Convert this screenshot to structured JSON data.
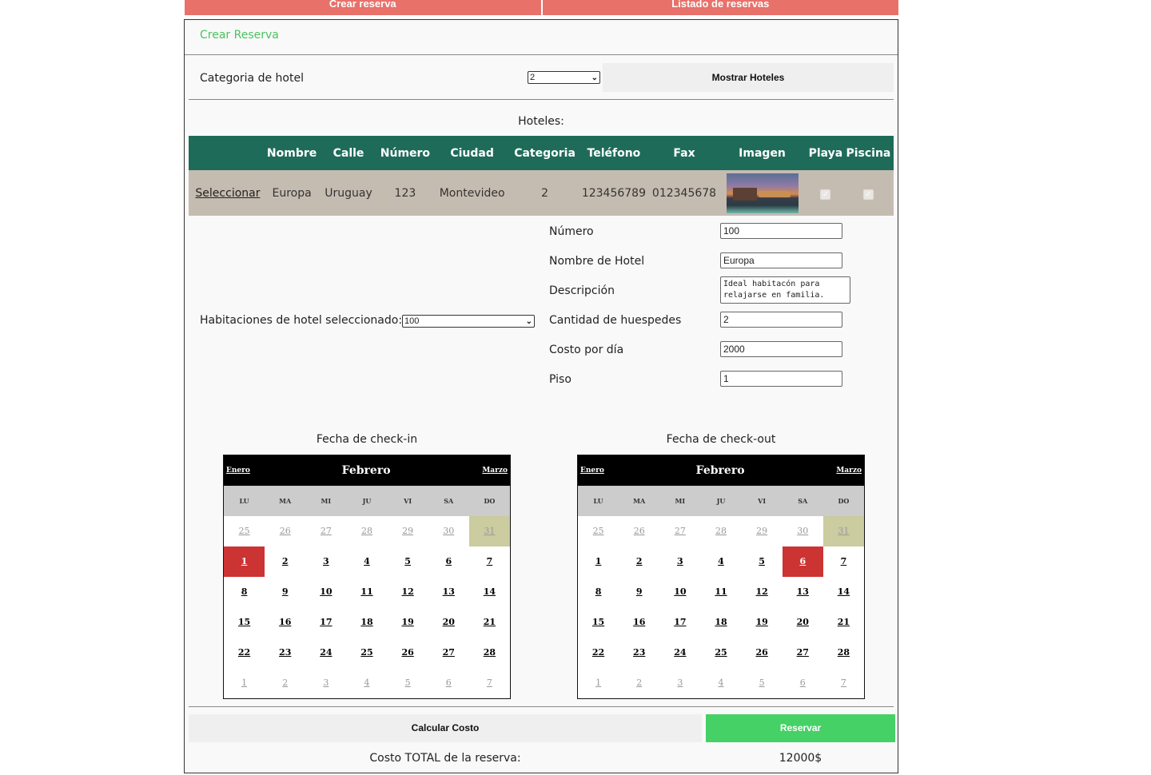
{
  "nav": {
    "crear": "Crear reserva",
    "listado": "Listado de reservas"
  },
  "panel": {
    "title": "Crear Reserva"
  },
  "categoria": {
    "label": "Categoria de hotel",
    "selected": "2",
    "button": "Mostrar Hoteles"
  },
  "hoteles": {
    "caption": "Hoteles:",
    "columns": [
      "",
      "Nombre",
      "Calle",
      "Número",
      "Ciudad",
      "Categoria",
      "Teléfono",
      "Fax",
      "Imagen",
      "Playa",
      "Piscina"
    ],
    "row": {
      "select": "Seleccionar",
      "nombre": "Europa",
      "calle": "Uruguay",
      "numero": "123",
      "ciudad": "Montevideo",
      "categoria": "2",
      "telefono": "123456789",
      "fax": "012345678",
      "playa": true,
      "piscina": true
    }
  },
  "habitaciones": {
    "label": "Habitaciones de hotel seleccionado:",
    "selected": "100"
  },
  "detalle": {
    "numero_label": "Número",
    "numero": "100",
    "nombre_label": "Nombre de Hotel",
    "nombre": "Europa",
    "descripcion_label": "Descripción",
    "descripcion": "Ideal habitacón para relajarse en familia.",
    "huespedes_label": "Cantidad de huespedes",
    "huespedes": "2",
    "costo_label": "Costo por día",
    "costo": "2000",
    "piso_label": "Piso",
    "piso": "1"
  },
  "checkin": {
    "title": "Fecha de check-in",
    "prev": "Enero",
    "month": "Febrero",
    "next": "Marzo",
    "dow": [
      "LU",
      "MA",
      "MI",
      "JU",
      "VI",
      "SA",
      "DO"
    ],
    "selected_day": 1,
    "weeks": [
      [
        "25",
        "26",
        "27",
        "28",
        "29",
        "30",
        "31"
      ],
      [
        "1",
        "2",
        "3",
        "4",
        "5",
        "6",
        "7"
      ],
      [
        "8",
        "9",
        "10",
        "11",
        "12",
        "13",
        "14"
      ],
      [
        "15",
        "16",
        "17",
        "18",
        "19",
        "20",
        "21"
      ],
      [
        "22",
        "23",
        "24",
        "25",
        "26",
        "27",
        "28"
      ],
      [
        "1",
        "2",
        "3",
        "4",
        "5",
        "6",
        "7"
      ]
    ]
  },
  "checkout": {
    "title": "Fecha de check-out",
    "prev": "Enero",
    "month": "Febrero",
    "next": "Marzo",
    "dow": [
      "LU",
      "MA",
      "MI",
      "JU",
      "VI",
      "SA",
      "DO"
    ],
    "selected_day": 6,
    "weeks": [
      [
        "25",
        "26",
        "27",
        "28",
        "29",
        "30",
        "31"
      ],
      [
        "1",
        "2",
        "3",
        "4",
        "5",
        "6",
        "7"
      ],
      [
        "8",
        "9",
        "10",
        "11",
        "12",
        "13",
        "14"
      ],
      [
        "15",
        "16",
        "17",
        "18",
        "19",
        "20",
        "21"
      ],
      [
        "22",
        "23",
        "24",
        "25",
        "26",
        "27",
        "28"
      ],
      [
        "1",
        "2",
        "3",
        "4",
        "5",
        "6",
        "7"
      ]
    ]
  },
  "actions": {
    "calcular": "Calcular Costo",
    "reservar": "Reservar"
  },
  "total": {
    "label": "Costo TOTAL de la reserva:",
    "value": "12000$"
  },
  "colors": {
    "nav": "#e8716a",
    "table_header": "#1f6b5a",
    "reservar": "#45d165",
    "selected_day": "#cc3333",
    "today": "#cbcc9f"
  }
}
